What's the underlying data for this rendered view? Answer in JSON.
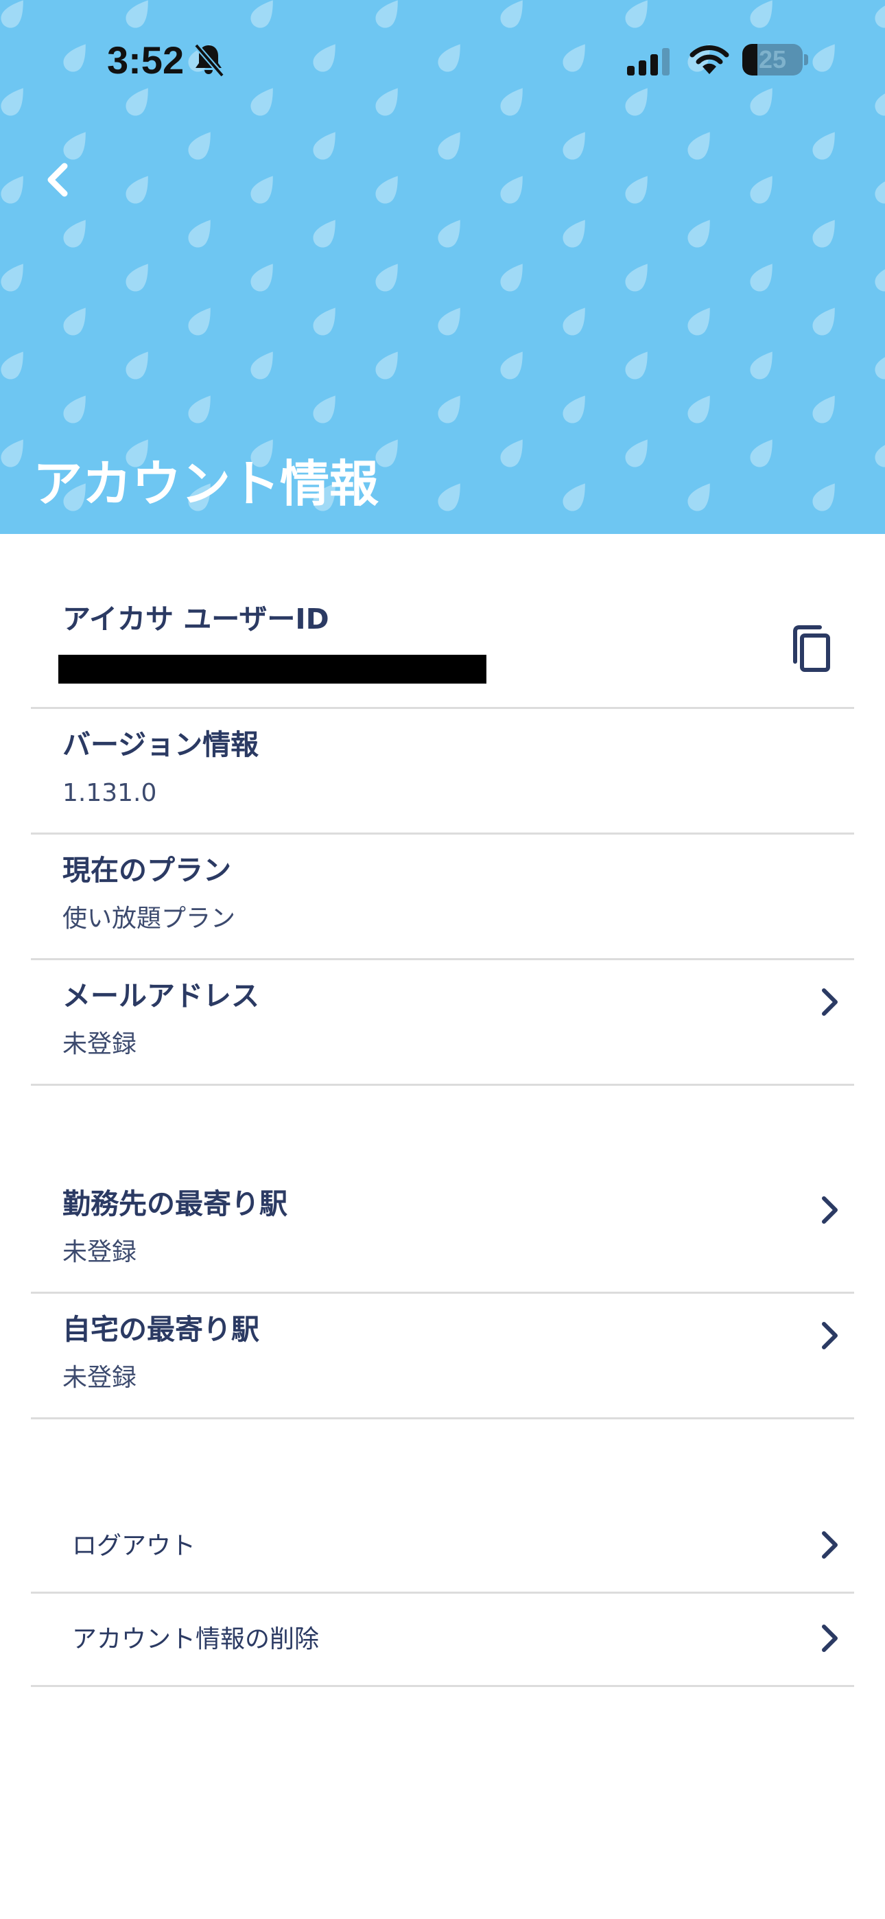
{
  "status_bar": {
    "time": "3:52",
    "battery_level": "25",
    "battery_percent": 25
  },
  "header": {
    "title": "アカウント情報",
    "background_color": "#6ec6f2"
  },
  "account": {
    "user_id_label": "アイカサ ユーザーID",
    "version_label": "バージョン情報",
    "version_value": "1.131.0",
    "plan_label": "現在のプラン",
    "plan_value": "使い放題プラン",
    "email_label": "メールアドレス",
    "email_value": "未登録"
  },
  "stations": {
    "work_label": "勤務先の最寄り駅",
    "work_value": "未登録",
    "home_label": "自宅の最寄り駅",
    "home_value": "未登録"
  },
  "actions": {
    "logout_label": "ログアウト",
    "delete_label": "アカウント情報の削除"
  },
  "icons": {
    "back": "chevron-left-icon",
    "copy": "copy-icon",
    "row_chevron": "chevron-right-icon",
    "bell": "bell-slash-icon",
    "signal": "signal-icon",
    "wifi": "wifi-icon"
  },
  "colors": {
    "text_primary": "#2b3a63",
    "divider": "#dcdcdc",
    "header_bg": "#6ec6f2"
  }
}
